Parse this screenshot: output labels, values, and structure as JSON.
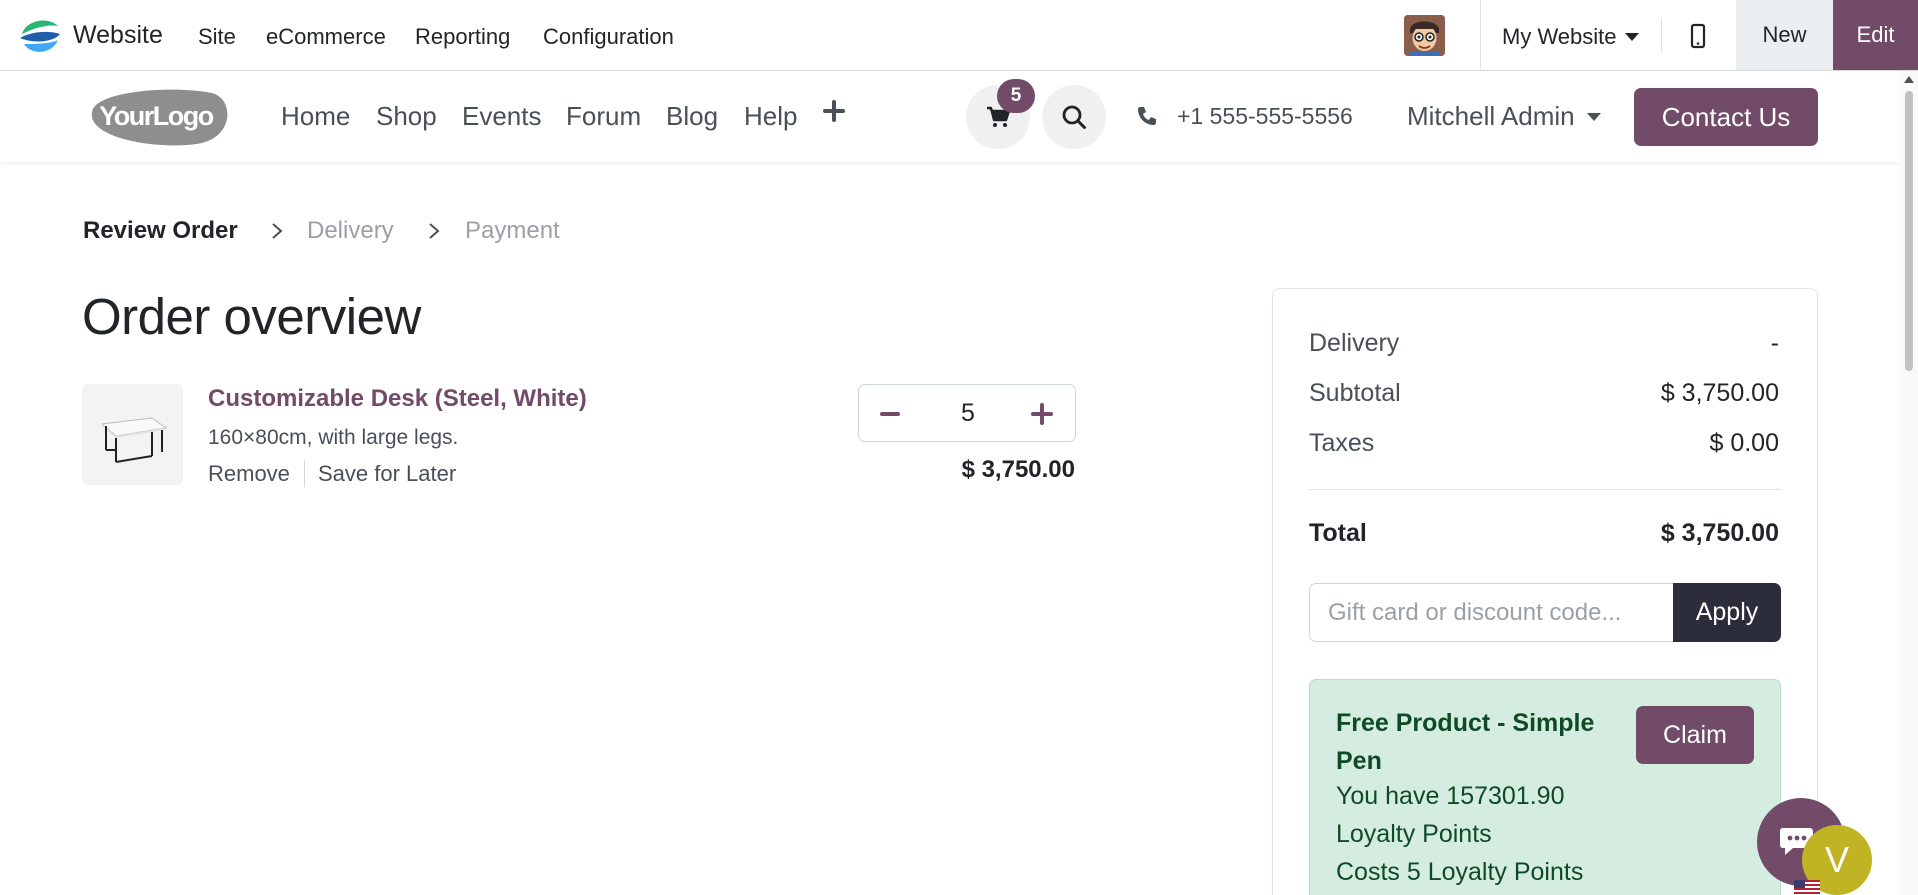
{
  "admin_bar": {
    "app_name": "Website",
    "menus": [
      "Site",
      "eCommerce",
      "Reporting",
      "Configuration"
    ],
    "website_selector": "My Website",
    "new_label": "New",
    "edit_label": "Edit"
  },
  "header": {
    "logo_text": "YourLogo",
    "nav": [
      "Home",
      "Shop",
      "Events",
      "Forum",
      "Blog",
      "Help"
    ],
    "cart_count": "5",
    "phone": "+1 555-555-5556",
    "user": "Mitchell Admin",
    "contact_label": "Contact Us"
  },
  "breadcrumb": {
    "steps": [
      "Review Order",
      "Delivery",
      "Payment"
    ]
  },
  "page_title": "Order overview",
  "cart_line": {
    "name": "Customizable Desk (Steel, White)",
    "description": "160×80cm, with large legs.",
    "remove_label": "Remove",
    "save_label": "Save for Later",
    "quantity": "5",
    "price": "$ 3,750.00"
  },
  "summary": {
    "delivery_label": "Delivery",
    "delivery_value": "-",
    "subtotal_label": "Subtotal",
    "subtotal_value": "$ 3,750.00",
    "taxes_label": "Taxes",
    "taxes_value": "$ 0.00",
    "total_label": "Total",
    "total_value": "$ 3,750.00",
    "promo_placeholder": "Gift card or discount code...",
    "apply_label": "Apply"
  },
  "reward": {
    "title": "Free Product - Simple Pen",
    "points_line1": "You have 157301.90",
    "points_line2": "Loyalty Points",
    "cost_line": "Costs 5 Loyalty Points",
    "claim_label": "Claim"
  },
  "widgets": {
    "visitor_initial": "V"
  },
  "colors": {
    "brand": "#714b67",
    "apply_bg": "#2b2d3a",
    "reward_bg": "#d5ede0",
    "reward_text": "#0f4a26",
    "visitor_avatar": "#c0b425"
  }
}
